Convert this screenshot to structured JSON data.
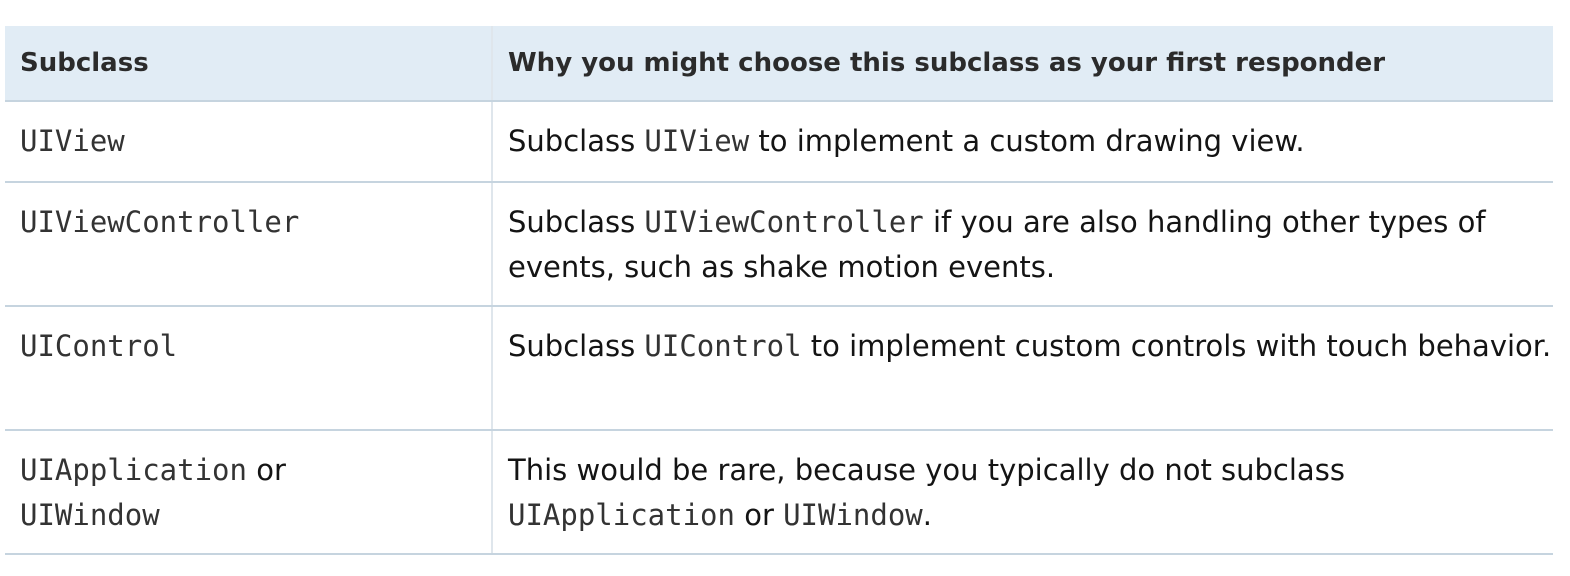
{
  "table": {
    "headers": {
      "subclass": "Subclass",
      "why": "Why you might choose this subclass as your first responder"
    },
    "rows": [
      {
        "subclass": "UIView",
        "why_pre": "Subclass ",
        "why_code": "UIView",
        "why_post": " to implement a custom drawing view."
      },
      {
        "subclass": "UIViewController",
        "why_pre": "Subclass ",
        "why_code": "UIViewController",
        "why_post": " if you are also handling other types of events, such as shake motion events."
      },
      {
        "subclass": "UIControl",
        "why_pre": "Subclass ",
        "why_code": "UIControl",
        "why_post": " to implement custom controls with touch behavior."
      },
      {
        "subclass_code1": "UIApplication",
        "subclass_join": " or",
        "subclass_code2": "UIWindow",
        "why_pre": "This would be rare, because you typically do not subclass ",
        "why_code1": "UIApplication",
        "why_join": " or ",
        "why_code2": "UIWindow",
        "why_post": "."
      }
    ]
  }
}
